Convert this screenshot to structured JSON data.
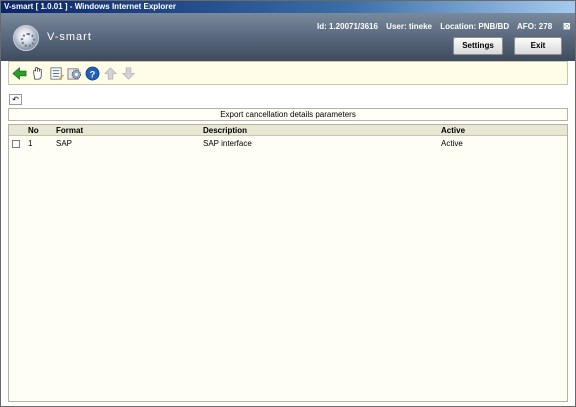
{
  "window": {
    "title": "V-smart [ 1.0.01 ] - Windows Internet Explorer"
  },
  "header": {
    "brand": "V-smart",
    "id_text": "Id: 1.20071/3616",
    "user_text": "User: tineke",
    "location_text": "Location: PNB/BD",
    "afo_text": "AFO: 278",
    "close_glyph": "⊠",
    "settings_label": "Settings",
    "exit_label": "Exit"
  },
  "toolbar": {
    "icons": [
      "back-arrow-icon",
      "hand-select-icon",
      "list-edit-icon",
      "settings-gear-icon",
      "help-icon",
      "up-arrow-icon",
      "down-arrow-icon"
    ],
    "colors": {
      "back": "#2e9d2e",
      "help": "#1f5fbf",
      "disabled": "#b9b9b9"
    }
  },
  "form": {
    "undo_glyph": "↶",
    "title": "Export cancellation details parameters"
  },
  "table": {
    "headers": {
      "no": "No",
      "format": "Format",
      "description": "Description",
      "active": "Active"
    },
    "rows": [
      {
        "no": "1",
        "format": "SAP",
        "description": "SAP interface",
        "active": "Active"
      }
    ]
  }
}
